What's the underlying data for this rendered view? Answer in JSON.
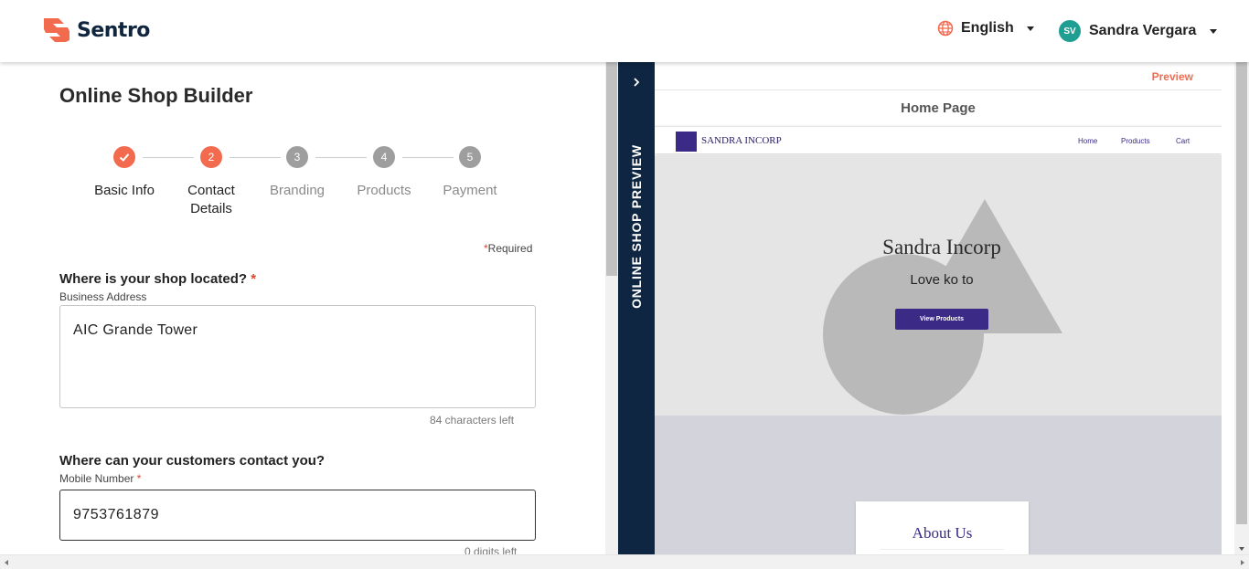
{
  "header": {
    "brand": "Sentro",
    "language": "English",
    "user_initials": "SV",
    "user_name": "Sandra Vergara",
    "colors": {
      "brand_orange": "#f26b4f",
      "navy": "#10263f",
      "avatar": "#1f9f92"
    }
  },
  "form": {
    "title": "Online Shop Builder",
    "steps": [
      {
        "number": "",
        "label": "Basic Info",
        "status": "done"
      },
      {
        "number": "2",
        "label": "Contact Details",
        "status": "active"
      },
      {
        "number": "3",
        "label": "Branding",
        "status": "todo"
      },
      {
        "number": "4",
        "label": "Products",
        "status": "todo"
      },
      {
        "number": "5",
        "label": "Payment",
        "status": "todo"
      }
    ],
    "required_note": "Required",
    "location_question": "Where is your shop located?",
    "address_label": "Business Address",
    "address_value": "AIC Grande Tower",
    "address_hint": "84 characters left",
    "contact_question": "Where can your customers contact you?",
    "mobile_label": "Mobile Number",
    "mobile_value": "9753761879",
    "mobile_hint": "0 digits left"
  },
  "preview": {
    "tab_label": "ONLINE SHOP PREVIEW",
    "preview_link": "Preview",
    "page_title": "Home Page",
    "shop_name": "SANDRA INCORP",
    "nav_items": [
      "Home",
      "Products",
      "Cart"
    ],
    "hero_title": "Sandra Incorp",
    "hero_subtitle": "Love ko to",
    "hero_button": "View Products",
    "about_title": "About Us",
    "colors": {
      "tab_bg": "#0e2642",
      "shop_accent": "#3b2a86",
      "hero_bg": "#e5e5e5",
      "about_bg": "#d3d3dc"
    }
  }
}
